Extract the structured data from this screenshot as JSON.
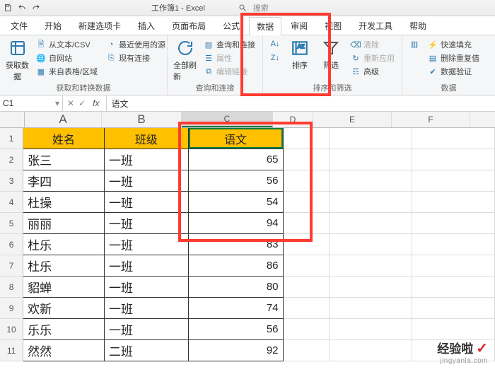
{
  "titlebar": {
    "title": "工作簿1 - Excel",
    "search_placeholder": "搜索"
  },
  "tabs": {
    "file": "文件",
    "home": "开始",
    "addin": "新建选项卡",
    "insert": "插入",
    "layout": "页面布局",
    "formulas": "公式",
    "data": "数据",
    "review": "审阅",
    "view": "视图",
    "dev": "开发工具",
    "help": "帮助"
  },
  "ribbon": {
    "group1": {
      "get_data": "获取数\n据",
      "from_text": "从文本/CSV",
      "from_web": "自网站",
      "from_table": "来自表格/区域",
      "recent": "最近使用的源",
      "existing": "现有连接",
      "label": "获取和转换数据"
    },
    "group2": {
      "refresh": "全部刷新",
      "queries": "查询和连接",
      "properties": "属性",
      "editlinks": "编辑链接",
      "label": "查询和连接"
    },
    "group3": {
      "sort": "排序",
      "filter": "筛选",
      "clear": "清除",
      "reapply": "重新应用",
      "advanced": "高级",
      "label": "排序和筛选"
    },
    "group4": {
      "flashfill": "快速填充",
      "removedup": "删除重复值",
      "validation": "数据验证",
      "label": "数据"
    }
  },
  "namebox": {
    "ref": "C1",
    "fx_value": "语文"
  },
  "columns": [
    "A",
    "B",
    "C",
    "D",
    "E",
    "F"
  ],
  "chart_data": {
    "type": "table",
    "title": "",
    "headers": [
      "姓名",
      "班级",
      "语文"
    ],
    "rows": [
      {
        "name": "张三",
        "class": "一班",
        "score": 65
      },
      {
        "name": "李四",
        "class": "一班",
        "score": 56
      },
      {
        "name": "杜操",
        "class": "一班",
        "score": 54
      },
      {
        "name": "丽丽",
        "class": "一班",
        "score": 94
      },
      {
        "name": "杜乐",
        "class": "一班",
        "score": 83
      },
      {
        "name": "杜乐",
        "class": "一班",
        "score": 86
      },
      {
        "name": "貂蝉",
        "class": "一班",
        "score": 80
      },
      {
        "name": "欢新",
        "class": "一班",
        "score": 74
      },
      {
        "name": "乐乐",
        "class": "一班",
        "score": 56
      },
      {
        "name": "然然",
        "class": "二班",
        "score": 92
      }
    ]
  },
  "watermark": {
    "line1": "经验啦",
    "check": "✓",
    "url": "jingyanla.com"
  }
}
